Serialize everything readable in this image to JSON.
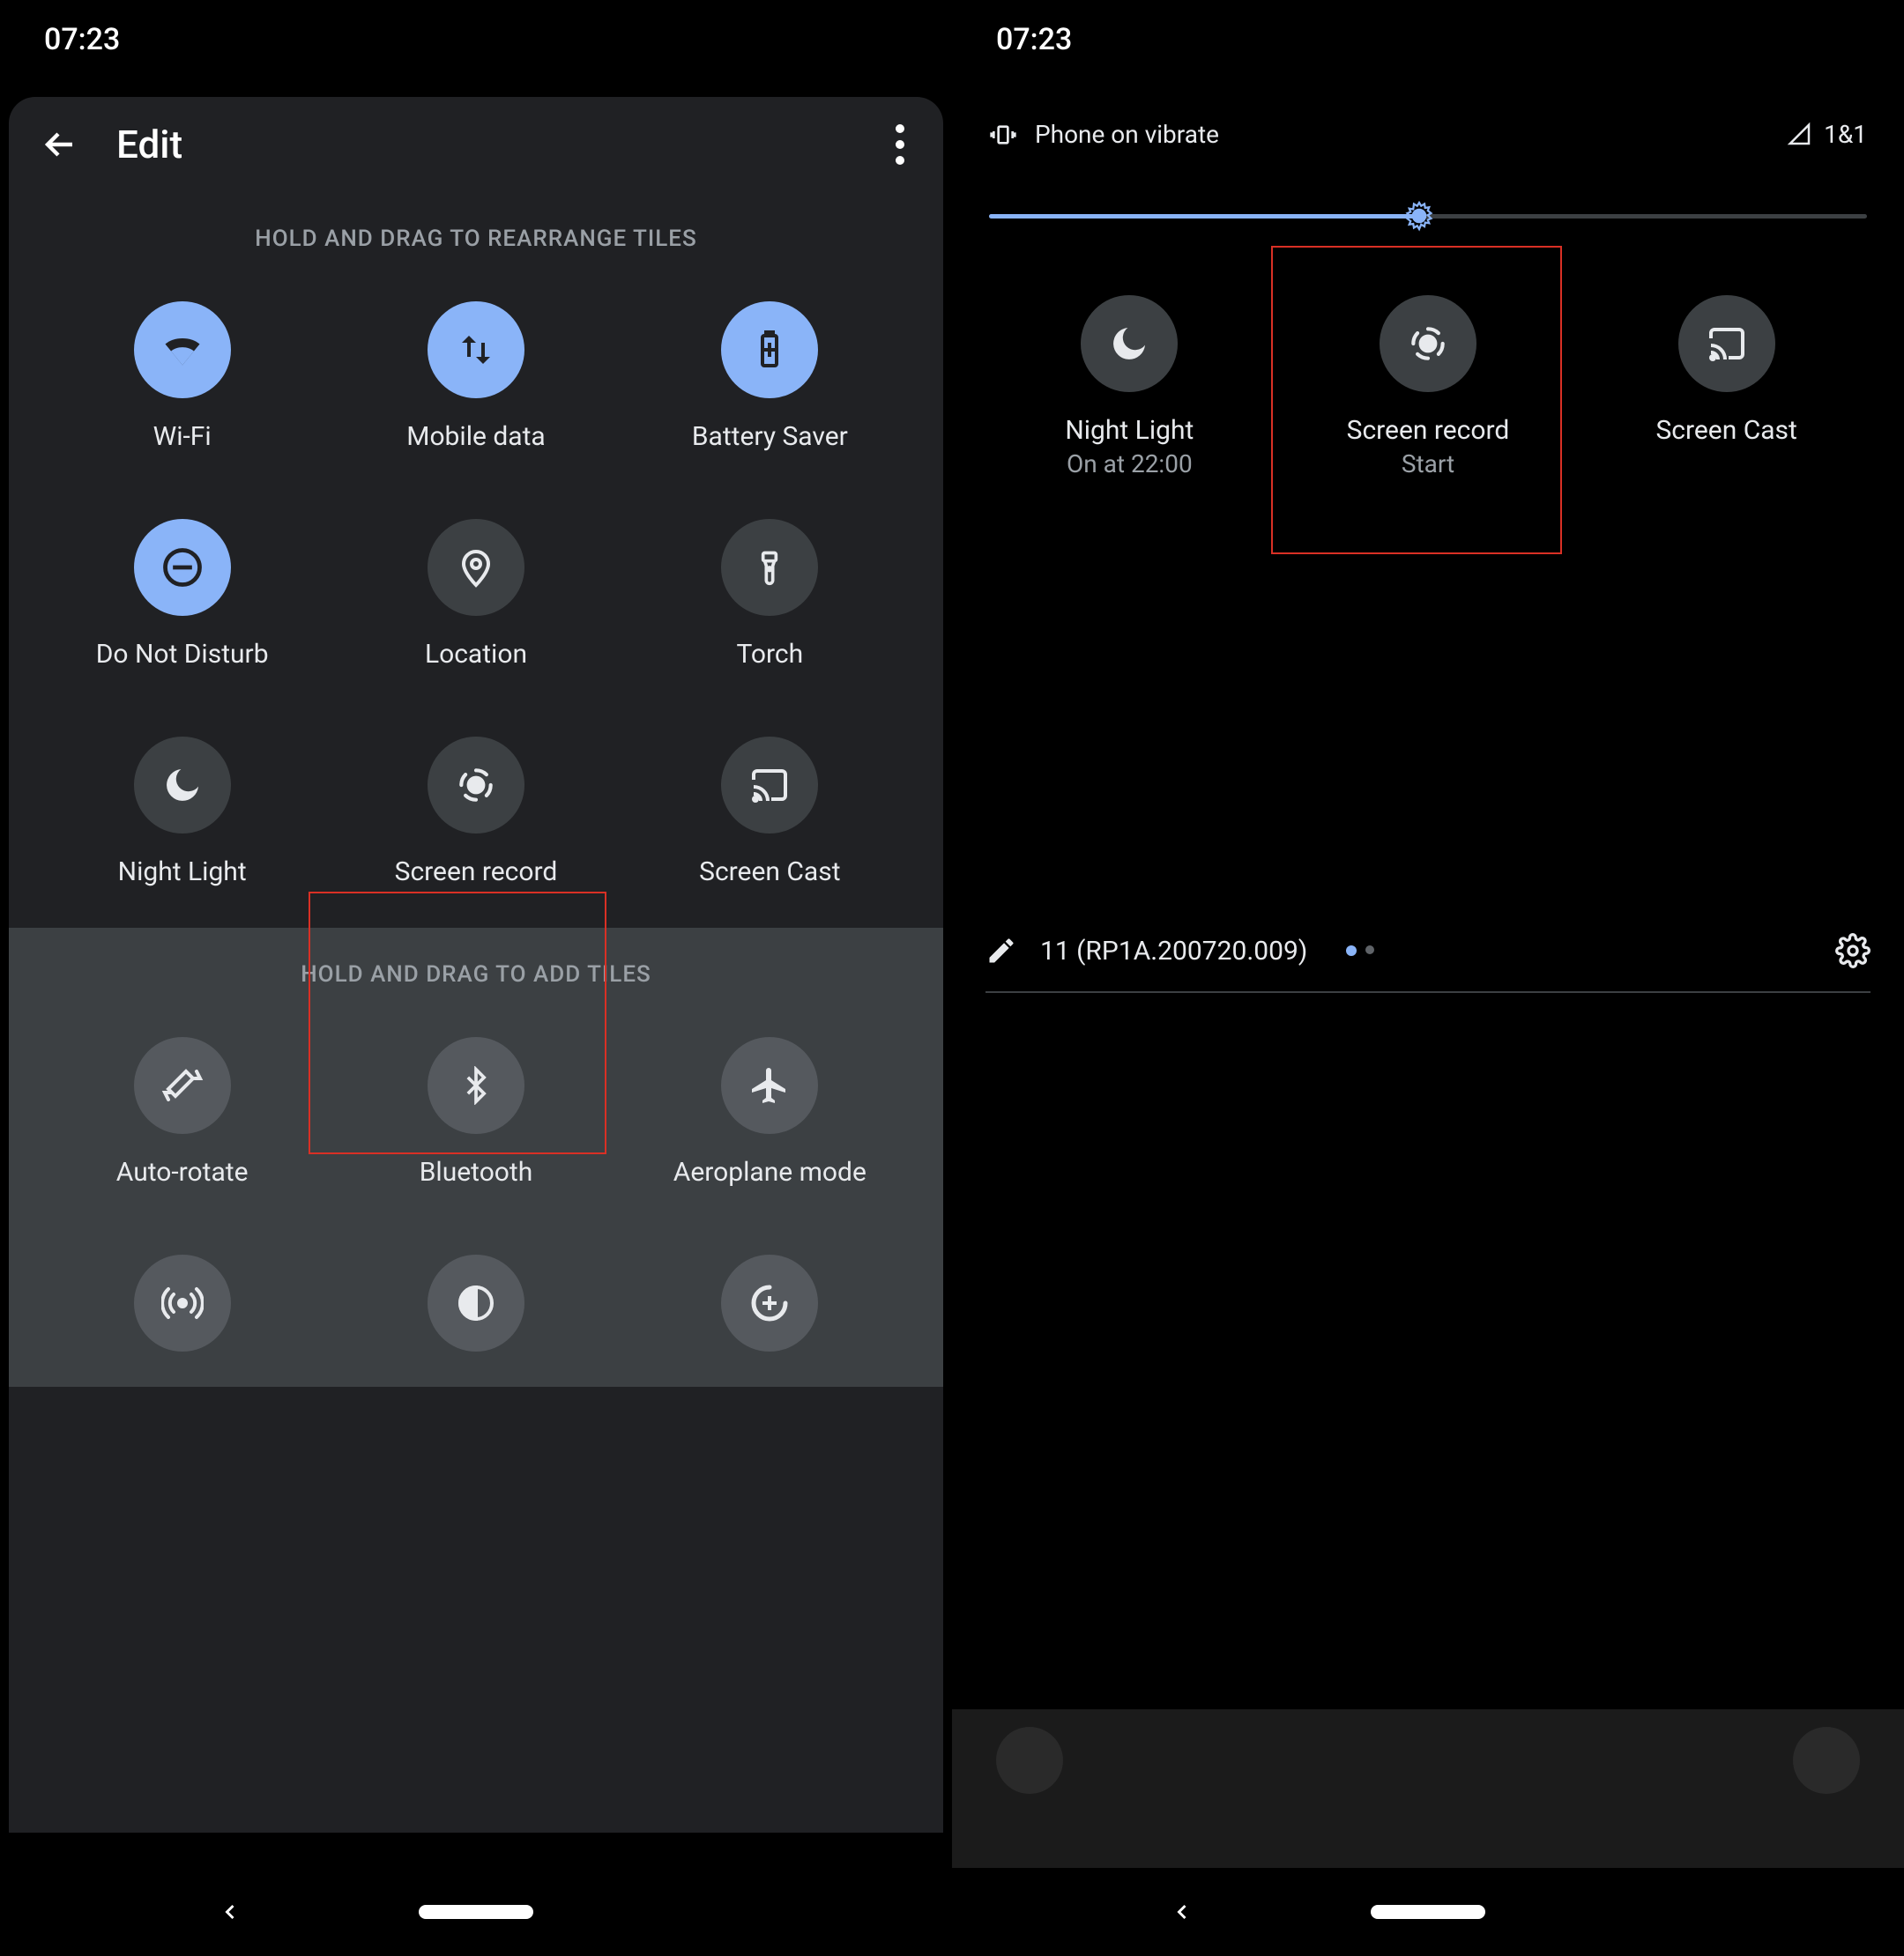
{
  "left": {
    "time": "07:23",
    "header": {
      "title": "Edit"
    },
    "section_rearrange": "HOLD AND DRAG TO REARRANGE TILES",
    "section_add": "HOLD AND DRAG TO ADD TILES",
    "tiles_active": [
      {
        "id": "wifi",
        "label": "Wi-Fi",
        "active": true
      },
      {
        "id": "mobile-data",
        "label": "Mobile data",
        "active": true
      },
      {
        "id": "battery-saver",
        "label": "Battery Saver",
        "active": true
      },
      {
        "id": "dnd",
        "label": "Do Not Disturb",
        "active": true
      },
      {
        "id": "location",
        "label": "Location",
        "active": false
      },
      {
        "id": "torch",
        "label": "Torch",
        "active": false
      },
      {
        "id": "night-light",
        "label": "Night Light",
        "active": false
      },
      {
        "id": "screen-record",
        "label": "Screen record",
        "active": false,
        "highlighted": true
      },
      {
        "id": "screen-cast",
        "label": "Screen Cast",
        "active": false
      }
    ],
    "tiles_add": [
      {
        "id": "auto-rotate",
        "label": "Auto-rotate"
      },
      {
        "id": "bluetooth",
        "label": "Bluetooth"
      },
      {
        "id": "aeroplane",
        "label": "Aeroplane mode"
      },
      {
        "id": "hotspot",
        "label": ""
      },
      {
        "id": "dark-theme",
        "label": ""
      },
      {
        "id": "data-saver",
        "label": ""
      }
    ]
  },
  "right": {
    "time": "07:23",
    "status": {
      "mode": "Phone on vibrate",
      "carrier": "1&1"
    },
    "brightness_percent": 49,
    "tiles": [
      {
        "id": "night-light",
        "label": "Night Light",
        "sub": "On at 22:00"
      },
      {
        "id": "screen-record",
        "label": "Screen record",
        "sub": "Start",
        "highlighted": true
      },
      {
        "id": "screen-cast",
        "label": "Screen Cast",
        "sub": ""
      }
    ],
    "footer": {
      "build": "11 (RP1A.200720.009)",
      "page_index": 1,
      "page_count": 2
    }
  },
  "colors": {
    "accent": "#8ab4f8",
    "tile_inactive": "#3c4043",
    "highlight_border": "#d93025"
  }
}
